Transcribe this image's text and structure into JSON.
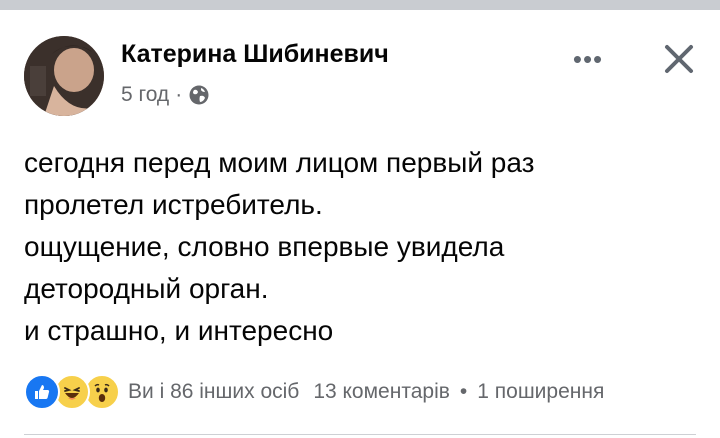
{
  "post": {
    "author": "Катерина Шибиневич",
    "time": "5 год",
    "dot": "·",
    "privacy_icon": "globe-icon",
    "lines": [
      "сегодня перед моим лицом первый раз",
      "пролетел истребитель.",
      "ощущение, словно впервые увидела",
      "детородный орган.",
      "и страшно, и интересно"
    ]
  },
  "header": {
    "more_label": "•••",
    "close_icon": "close-icon"
  },
  "footer": {
    "reaction_icons": [
      "like-reaction-icon",
      "haha-reaction-icon",
      "wow-reaction-icon"
    ],
    "reactors_text": "Ви і 86 інших осіб",
    "comments_text": "13 коментарів",
    "separator": "•",
    "shares_text": "1 поширення"
  },
  "colors": {
    "text_primary": "#050505",
    "text_secondary": "#65676b",
    "like_blue": "#1877f2",
    "emoji_yellow": "#f7d04b",
    "divider": "#ced0d4"
  }
}
